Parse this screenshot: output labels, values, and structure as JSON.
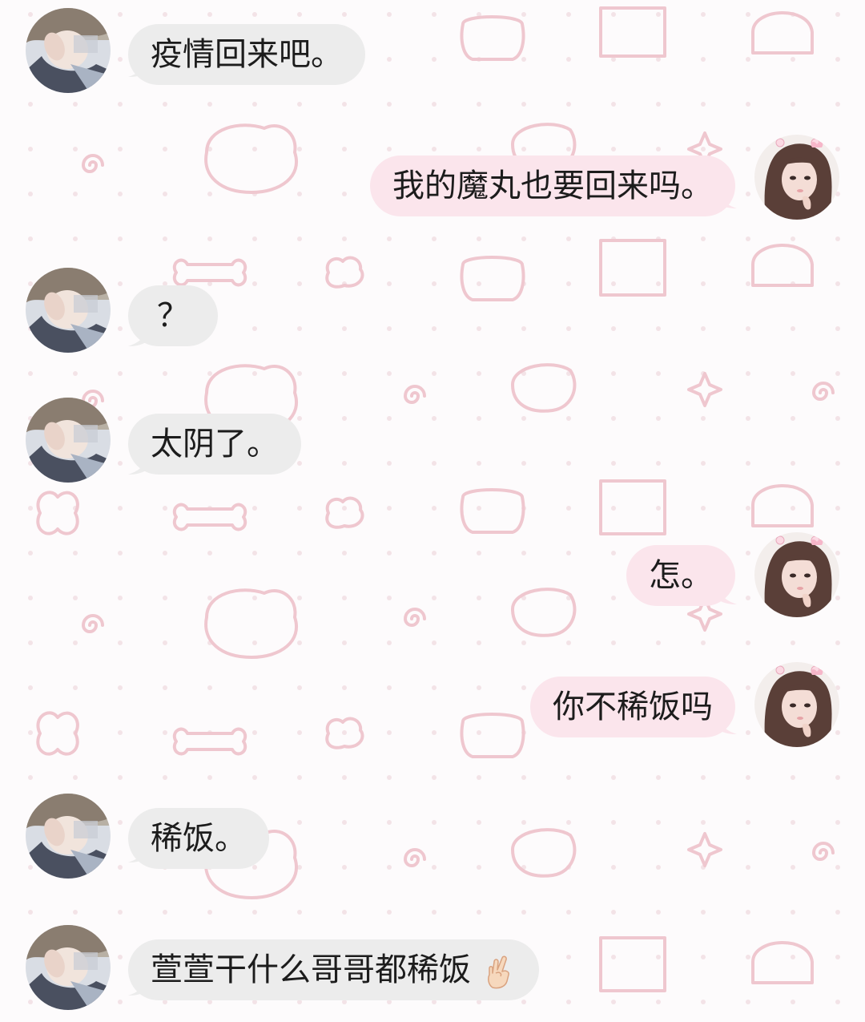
{
  "chat": {
    "colors": {
      "background": "#fdfbfc",
      "pattern": "#efc7cf",
      "bubble_left": "#ececec",
      "bubble_right": "#fbe5ec",
      "text": "#1c1c1c"
    },
    "messages": [
      {
        "sender": "left",
        "text": "疫情回来吧。"
      },
      {
        "sender": "right",
        "text": "我的魔丸也要回来吗。"
      },
      {
        "sender": "left",
        "text": "？"
      },
      {
        "sender": "left",
        "text": "太阴了。"
      },
      {
        "sender": "right",
        "text": "怎。"
      },
      {
        "sender": "right",
        "text": "你不稀饭吗"
      },
      {
        "sender": "left",
        "text": "稀饭。"
      },
      {
        "sender": "left",
        "text": "萱萱干什么哥哥都稀饭",
        "emoji": "crossed-fingers-emoji"
      }
    ]
  }
}
